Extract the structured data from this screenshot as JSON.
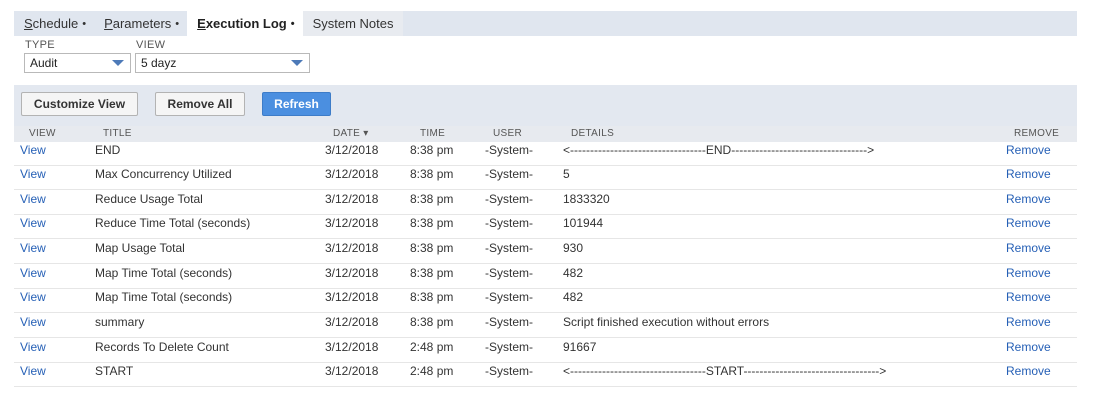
{
  "tabs": [
    {
      "label": "Schedule",
      "mnemonic": "S",
      "rest": "chedule",
      "dot": "•"
    },
    {
      "label": "Parameters",
      "mnemonic": "P",
      "rest": "arameters",
      "dot": "•"
    },
    {
      "label": "Execution Log",
      "mnemonic": "E",
      "rest": "xecution Log",
      "dot": "•"
    },
    {
      "label": "System Notes"
    }
  ],
  "filters": {
    "type_label": "TYPE",
    "type_value": "Audit",
    "view_label": "VIEW",
    "view_value": "5 dayz"
  },
  "buttons": {
    "customize": "Customize View",
    "remove_all": "Remove All",
    "refresh": "Refresh"
  },
  "table": {
    "headers": {
      "view": "VIEW",
      "title": "TITLE",
      "date": "DATE ▾",
      "time": "TIME",
      "user": "USER",
      "details": "DETAILS",
      "remove": "REMOVE"
    },
    "rows": [
      {
        "view": "View",
        "title": "END",
        "date": "3/12/2018",
        "time": "8:38 pm",
        "user": "-System-",
        "details": "<----------------------------------END---------------------------------->",
        "remove": "Remove"
      },
      {
        "view": "View",
        "title": "Max Concurrency Utilized",
        "date": "3/12/2018",
        "time": "8:38 pm",
        "user": "-System-",
        "details": "5",
        "remove": "Remove"
      },
      {
        "view": "View",
        "title": "Reduce Usage Total",
        "date": "3/12/2018",
        "time": "8:38 pm",
        "user": "-System-",
        "details": "1833320",
        "remove": "Remove"
      },
      {
        "view": "View",
        "title": "Reduce Time Total (seconds)",
        "date": "3/12/2018",
        "time": "8:38 pm",
        "user": "-System-",
        "details": "101944",
        "remove": "Remove"
      },
      {
        "view": "View",
        "title": "Map Usage Total",
        "date": "3/12/2018",
        "time": "8:38 pm",
        "user": "-System-",
        "details": "930",
        "remove": "Remove"
      },
      {
        "view": "View",
        "title": "Map Time Total (seconds)",
        "date": "3/12/2018",
        "time": "8:38 pm",
        "user": "-System-",
        "details": "482",
        "remove": "Remove"
      },
      {
        "view": "View",
        "title": "Map Time Total (seconds)",
        "date": "3/12/2018",
        "time": "8:38 pm",
        "user": "-System-",
        "details": "482",
        "remove": "Remove"
      },
      {
        "view": "View",
        "title": "summary",
        "date": "3/12/2018",
        "time": "8:38 pm",
        "user": "-System-",
        "details": "Script finished execution without errors",
        "remove": "Remove"
      },
      {
        "view": "View",
        "title": "Records To Delete Count",
        "date": "3/12/2018",
        "time": "2:48 pm",
        "user": "-System-",
        "details": "91667",
        "remove": "Remove"
      },
      {
        "view": "View",
        "title": "START",
        "date": "3/12/2018",
        "time": "2:48 pm",
        "user": "-System-",
        "details": "<----------------------------------START---------------------------------->",
        "remove": "Remove"
      }
    ]
  },
  "colors": {
    "accent": "#4b8fe0",
    "link": "#2660b6",
    "header_bg": "#e0e6ef"
  }
}
